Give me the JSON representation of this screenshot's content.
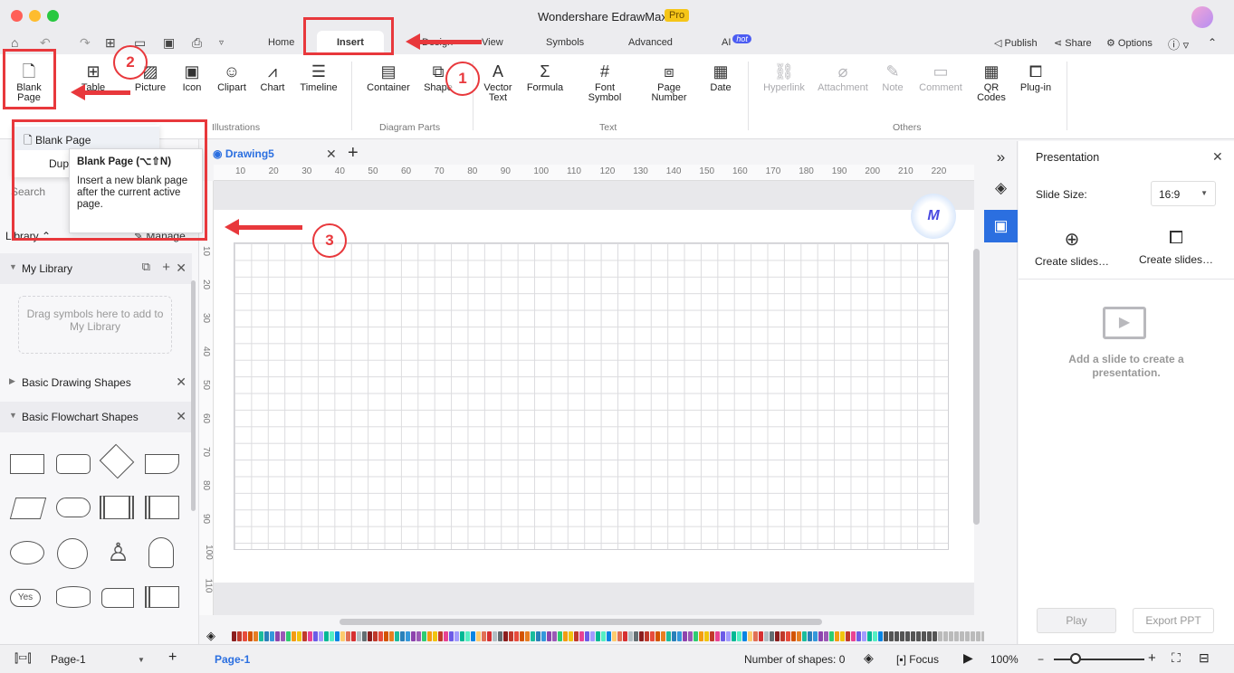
{
  "window": {
    "title": "Wondershare EdrawMax",
    "badge": "Pro"
  },
  "menu": {
    "tabs": [
      "Home",
      "Insert",
      "Design",
      "View",
      "Symbols",
      "Advanced",
      "AI"
    ],
    "ai_badge": "hot",
    "right": [
      "Publish",
      "Share",
      "Options"
    ]
  },
  "ribbon": {
    "blank_page": "Blank Page",
    "table": "Table",
    "picture": "Picture",
    "icon": "Icon",
    "clipart": "Clipart",
    "chart": "Chart",
    "timeline": "Timeline",
    "container": "Container",
    "shape": "Shape",
    "vector_text": "Vector Text",
    "formula": "Formula",
    "font_symbol": "Font Symbol",
    "page_number": "Page Number",
    "date": "Date",
    "hyperlink": "Hyperlink",
    "attachment": "Attachment",
    "note": "Note",
    "comment": "Comment",
    "qr_codes": "QR Codes",
    "plugin": "Plug-in",
    "groups": [
      "Illustrations",
      "Diagram Parts",
      "Text",
      "Others"
    ]
  },
  "dropdown": {
    "items": [
      "Blank Page",
      "Dup"
    ]
  },
  "tooltip": {
    "title": "Blank Page (⌥⇧N)",
    "body": "Insert a new blank page after the current active page."
  },
  "library": {
    "search_placeholder": "Search",
    "header": "Library",
    "manage": "Manage",
    "my_library": "My Library",
    "drop_hint": "Drag symbols here to add to My Library",
    "basic_drawing": "Basic Drawing Shapes",
    "basic_flowchart": "Basic Flowchart Shapes",
    "yes_shape": "Yes"
  },
  "document": {
    "tab": "Drawing5",
    "ruler_h": [
      "10",
      "20",
      "30",
      "40",
      "50",
      "60",
      "70",
      "80",
      "90",
      "100",
      "110",
      "120",
      "130",
      "140",
      "150",
      "160",
      "170",
      "180",
      "190",
      "200",
      "210",
      "220"
    ],
    "ruler_v": [
      "10",
      "20",
      "30",
      "40",
      "50",
      "60",
      "70",
      "80",
      "90",
      "100",
      "110"
    ]
  },
  "presentation": {
    "title": "Presentation",
    "slide_size_label": "Slide Size:",
    "slide_size_value": "16:9",
    "create1": "Create slides…",
    "create2": "Create slides…",
    "empty_text": "Add a slide to create a presentation.",
    "play": "Play",
    "export": "Export PPT"
  },
  "status": {
    "page_select": "Page-1",
    "page_tab": "Page-1",
    "shapes_count": "Number of shapes: 0",
    "focus": "Focus",
    "zoom": "100%"
  },
  "annotations": {
    "step1": "1",
    "step2": "2",
    "step3": "3"
  },
  "colors": {
    "accent": "#2b6fe0",
    "annotation": "#e8383c"
  }
}
